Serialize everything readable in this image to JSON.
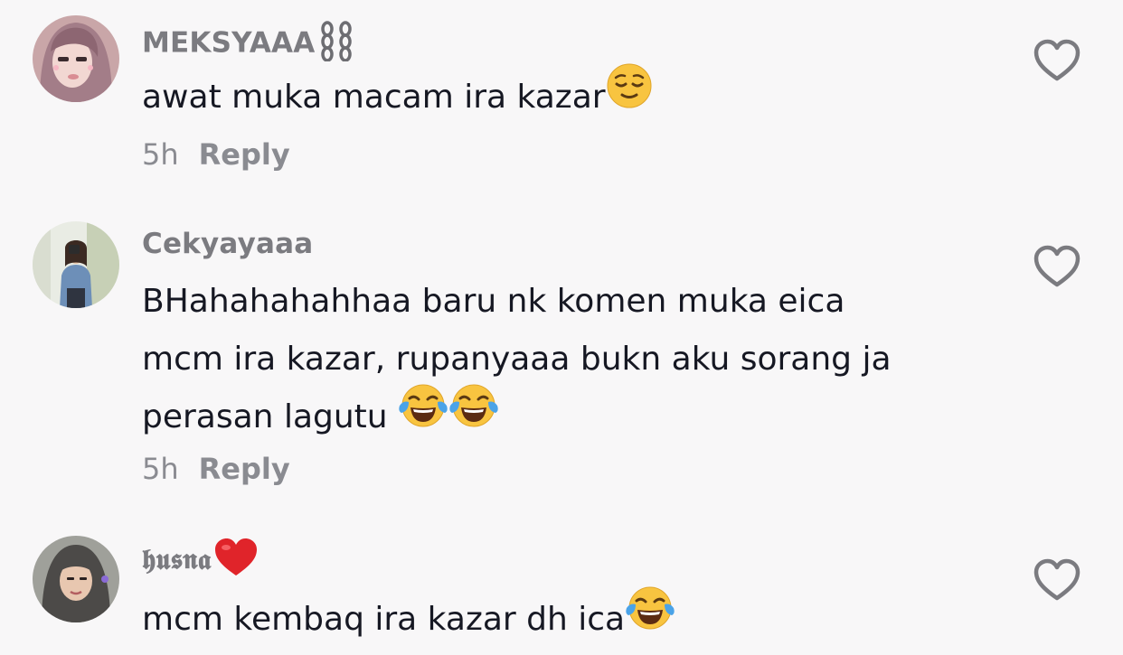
{
  "comments": [
    {
      "username": "MEKSYAAA",
      "username_emoji": "chain-icon",
      "text": "awat muka macam ira kazar",
      "text_emojis": [
        "relieved-face-icon"
      ],
      "time": "5h",
      "reply_label": "Reply"
    },
    {
      "username": "Cekyayaaa",
      "text_lines": [
        "BHahahahahhaa baru nk komen muka eica",
        "mcm ira kazar, rupanyaaa bukn aku sorang ja",
        "perasan lagutu "
      ],
      "text_emojis": [
        "tears-of-joy-icon",
        "tears-of-joy-icon"
      ],
      "time": "5h",
      "reply_label": "Reply"
    },
    {
      "username": "𝖍𝖚𝖘𝖓𝖆",
      "username_emoji": "red-heart-icon",
      "text": "mcm kembaq ira kazar dh ica",
      "text_emojis": [
        "tears-of-joy-icon"
      ]
    }
  ],
  "colors": {
    "background": "#f8f7f8",
    "username": "#7b7b80",
    "text": "#161823",
    "meta": "#8a8b91"
  }
}
